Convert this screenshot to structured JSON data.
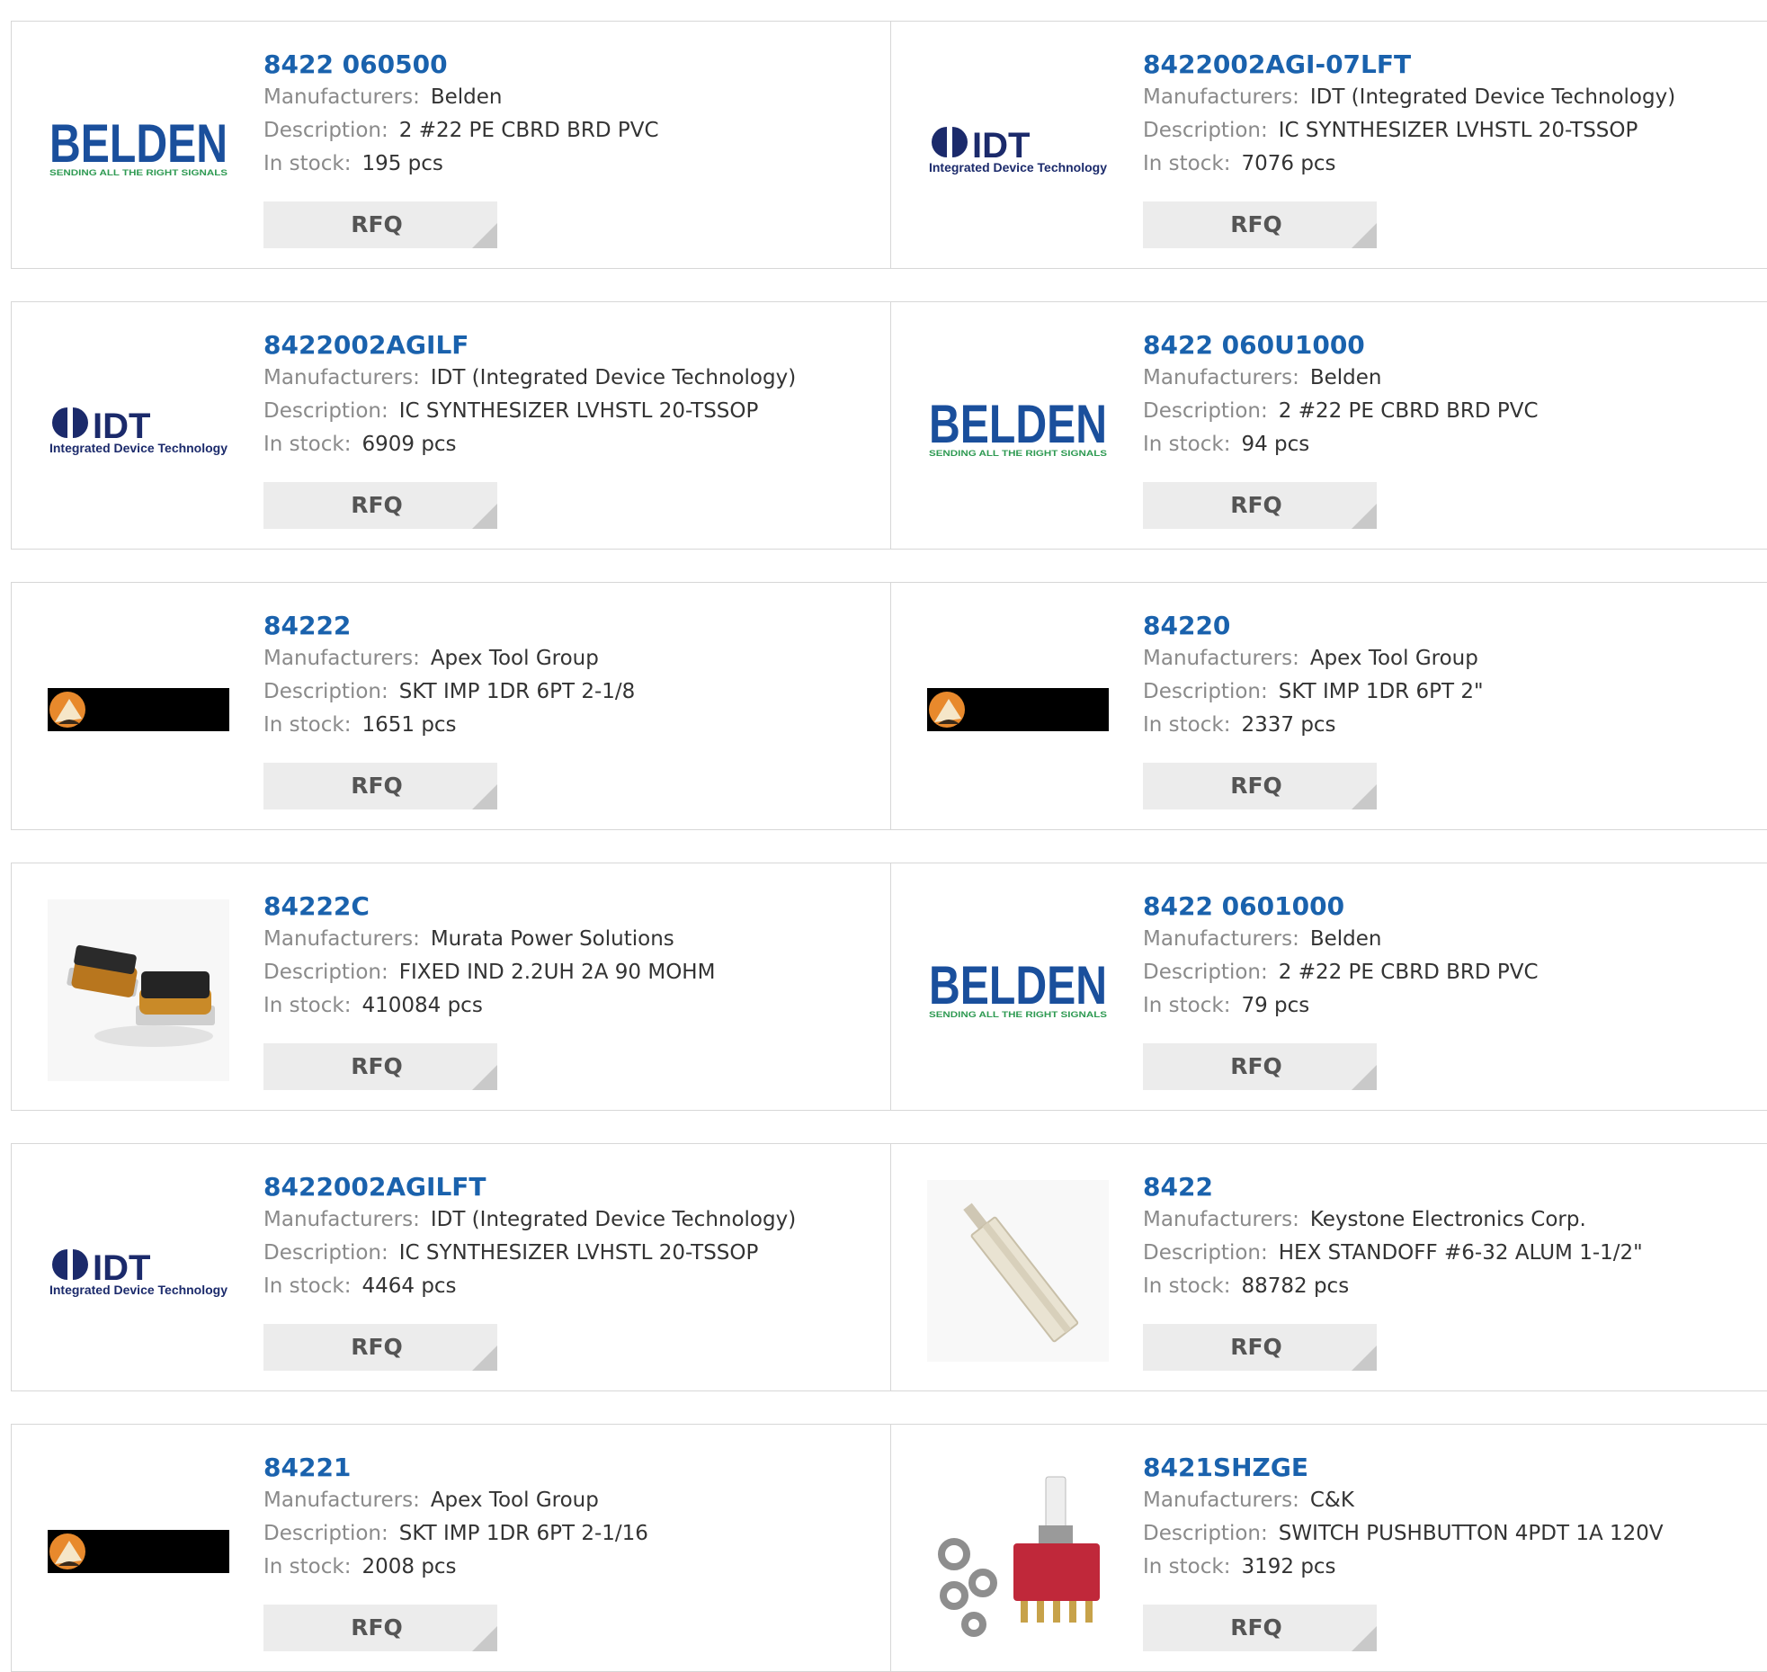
{
  "labels": {
    "manufacturers": "Manufacturers:",
    "description": "Description:",
    "in_stock": "In stock:",
    "rfq": "RFQ"
  },
  "colors": {
    "part_link": "#1a62ad",
    "label": "#8a8a8a",
    "value": "#333333",
    "rfq_bg": "#ececec",
    "border": "#d7d7d7"
  },
  "products": [
    {
      "part": "8422 060500",
      "manufacturer": "Belden",
      "description": "2 #22 PE CBRD BRD PVC",
      "stock": "195 pcs",
      "logo": "belden-logo",
      "logo_text": "BELDEN",
      "logo_tagline": "SENDING ALL THE RIGHT SIGNALS"
    },
    {
      "part": "8422002AGI-07LFT",
      "manufacturer": "IDT (Integrated Device Technology)",
      "description": "IC SYNTHESIZER LVHSTL 20-TSSOP",
      "stock": "7076 pcs",
      "logo": "idt-logo",
      "logo_text": "IDT",
      "logo_tagline": "Integrated Device Technology"
    },
    {
      "part": "8422002AGILF",
      "manufacturer": "IDT (Integrated Device Technology)",
      "description": "IC SYNTHESIZER LVHSTL 20-TSSOP",
      "stock": "6909 pcs",
      "logo": "idt-logo",
      "logo_text": "IDT",
      "logo_tagline": "Integrated Device Technology"
    },
    {
      "part": "8422 060U1000",
      "manufacturer": "Belden",
      "description": "2 #22 PE CBRD BRD PVC",
      "stock": "94 pcs",
      "logo": "belden-logo",
      "logo_text": "BELDEN",
      "logo_tagline": "SENDING ALL THE RIGHT SIGNALS"
    },
    {
      "part": "84222",
      "manufacturer": "Apex Tool Group",
      "description": "SKT IMP 1DR 6PT 2-1/8",
      "stock": "1651 pcs",
      "logo": "apex-logo"
    },
    {
      "part": "84220",
      "manufacturer": "Apex Tool Group",
      "description": "SKT IMP 1DR 6PT 2\"",
      "stock": "2337 pcs",
      "logo": "apex-logo"
    },
    {
      "part": "84222C",
      "manufacturer": "Murata Power Solutions",
      "description": "FIXED IND 2.2UH 2A 90 MOHM",
      "stock": "410084 pcs",
      "logo": "inductor-photo"
    },
    {
      "part": "8422 0601000",
      "manufacturer": "Belden",
      "description": "2 #22 PE CBRD BRD PVC",
      "stock": "79 pcs",
      "logo": "belden-logo",
      "logo_text": "BELDEN",
      "logo_tagline": "SENDING ALL THE RIGHT SIGNALS"
    },
    {
      "part": "8422002AGILFT",
      "manufacturer": "IDT (Integrated Device Technology)",
      "description": "IC SYNTHESIZER LVHSTL 20-TSSOP",
      "stock": "4464 pcs",
      "logo": "idt-logo",
      "logo_text": "IDT",
      "logo_tagline": "Integrated Device Technology"
    },
    {
      "part": "8422",
      "manufacturer": "Keystone Electronics Corp.",
      "description": "HEX STANDOFF #6-32 ALUM 1-1/2\"",
      "stock": "88782 pcs",
      "logo": "standoff-photo"
    },
    {
      "part": "84221",
      "manufacturer": "Apex Tool Group",
      "description": "SKT IMP 1DR 6PT 2-1/16",
      "stock": "2008 pcs",
      "logo": "apex-logo"
    },
    {
      "part": "8421SHZGE",
      "manufacturer": "C&K",
      "description": "SWITCH PUSHBUTTON 4PDT 1A 120V",
      "stock": "3192 pcs",
      "logo": "switch-photo"
    }
  ]
}
